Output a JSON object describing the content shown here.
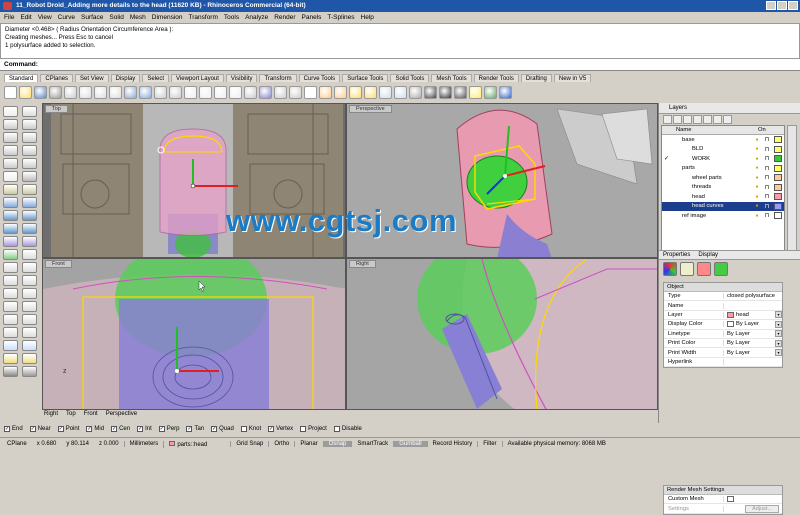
{
  "window": {
    "title": "11_Robot Droid_Adding more details to the head (11620 KB) - Rhinoceros Commercial (64-bit)"
  },
  "menu": [
    "File",
    "Edit",
    "View",
    "Curve",
    "Surface",
    "Solid",
    "Mesh",
    "Dimension",
    "Transform",
    "Tools",
    "Analyze",
    "Render",
    "Panels",
    "T-Splines",
    "Help"
  ],
  "command_history": [
    "Diameter <0.468> ( Radius  Orientation  Circumference  Area ):",
    "Creating meshes... Press Esc to cancel",
    "1 polysurface added to selection."
  ],
  "command_prompt": "Command:",
  "toolbar_tabs": [
    "Standard",
    "CPlanes",
    "Set View",
    "Display",
    "Select",
    "Viewport Layout",
    "Visibility",
    "Transform",
    "Curve Tools",
    "Surface Tools",
    "Solid Tools",
    "Mesh Tools",
    "Render Tools",
    "Drafting",
    "New in V5"
  ],
  "viewports": {
    "top": "Top",
    "perspective": "Perspective",
    "front": "Front",
    "right": "Right"
  },
  "viewport_tabs": [
    "Right",
    "Top",
    "Front",
    "Perspective"
  ],
  "layers_panel": {
    "tab": "Layers",
    "columns": [
      "Name",
      "On"
    ],
    "rows": [
      {
        "name": "base",
        "indent": 1,
        "color": "#ffff66",
        "selected": false,
        "check": ""
      },
      {
        "name": "BLD",
        "indent": 2,
        "color": "#ffff66",
        "selected": false,
        "check": ""
      },
      {
        "name": "WORK",
        "indent": 2,
        "color": "#33cc33",
        "selected": false,
        "check": "✓"
      },
      {
        "name": "parts",
        "indent": 1,
        "color": "#ffff66",
        "selected": false,
        "check": ""
      },
      {
        "name": "wheel parts",
        "indent": 2,
        "color": "#ffcc99",
        "selected": false,
        "check": ""
      },
      {
        "name": "threads",
        "indent": 2,
        "color": "#ffcc99",
        "selected": false,
        "check": ""
      },
      {
        "name": "head",
        "indent": 2,
        "color": "#ff99aa",
        "selected": false,
        "check": ""
      },
      {
        "name": "head curves",
        "indent": 2,
        "color": "#9999ff",
        "selected": true,
        "check": ""
      },
      {
        "name": "ref image",
        "indent": 1,
        "color": "#ffffff",
        "selected": false,
        "check": ""
      }
    ]
  },
  "properties_panel": {
    "tabs": [
      "Properties",
      "Display"
    ],
    "group": "Object",
    "rows": [
      {
        "key": "Type",
        "value": "closed polysurface",
        "swatch": "",
        "dropdown": false
      },
      {
        "key": "Name",
        "value": "",
        "swatch": "",
        "dropdown": false
      },
      {
        "key": "Layer",
        "value": "head",
        "swatch": "#ff99aa",
        "dropdown": true
      },
      {
        "key": "Display Color",
        "value": "By Layer",
        "swatch": "#ffffff",
        "dropdown": true
      },
      {
        "key": "Linetype",
        "value": "By Layer",
        "swatch": "",
        "dropdown": true
      },
      {
        "key": "Print Color",
        "value": "By Layer",
        "swatch": "",
        "dropdown": true
      },
      {
        "key": "Print Width",
        "value": "By Layer",
        "swatch": "",
        "dropdown": true
      },
      {
        "key": "Hyperlink",
        "value": "",
        "swatch": "",
        "dropdown": false
      }
    ],
    "render_group": "Render Mesh Settings",
    "custom_mesh": "Custom Mesh",
    "settings": "Settings",
    "adjust": "Adjust..."
  },
  "osnaps": [
    {
      "label": "End",
      "checked": true
    },
    {
      "label": "Near",
      "checked": true
    },
    {
      "label": "Point",
      "checked": true
    },
    {
      "label": "Mid",
      "checked": true
    },
    {
      "label": "Cen",
      "checked": true
    },
    {
      "label": "Int",
      "checked": true
    },
    {
      "label": "Perp",
      "checked": true
    },
    {
      "label": "Tan",
      "checked": true
    },
    {
      "label": "Quad",
      "checked": true
    },
    {
      "label": "Knot",
      "checked": false
    },
    {
      "label": "Vertex",
      "checked": true
    },
    {
      "label": "Project",
      "checked": false
    },
    {
      "label": "Disable",
      "checked": false
    }
  ],
  "statusbar": {
    "cplane": "CPlane",
    "x": "x 0.680",
    "y": "y 80.114",
    "z": "z 0.000",
    "units": "Millimeters",
    "layer": "parts::head",
    "buttons": [
      "Grid Snap",
      "Ortho",
      "Planar",
      "Osnap",
      "SmartTrack",
      "Gumball",
      "Record History",
      "Filter"
    ],
    "active": [
      "Osnap",
      "Gumball"
    ],
    "memory": "Available physical memory: 8068 MB"
  },
  "watermark": "www.cgtsj.com",
  "colors": {
    "title_bar": "#1f56a8",
    "selection": "#1d3e8c",
    "gumball_x": "#e02020",
    "gumball_y": "#20c020",
    "gumball_z": "#2030e0",
    "selected_curves": "#ffd800",
    "watermark": "#1a7cc6"
  }
}
